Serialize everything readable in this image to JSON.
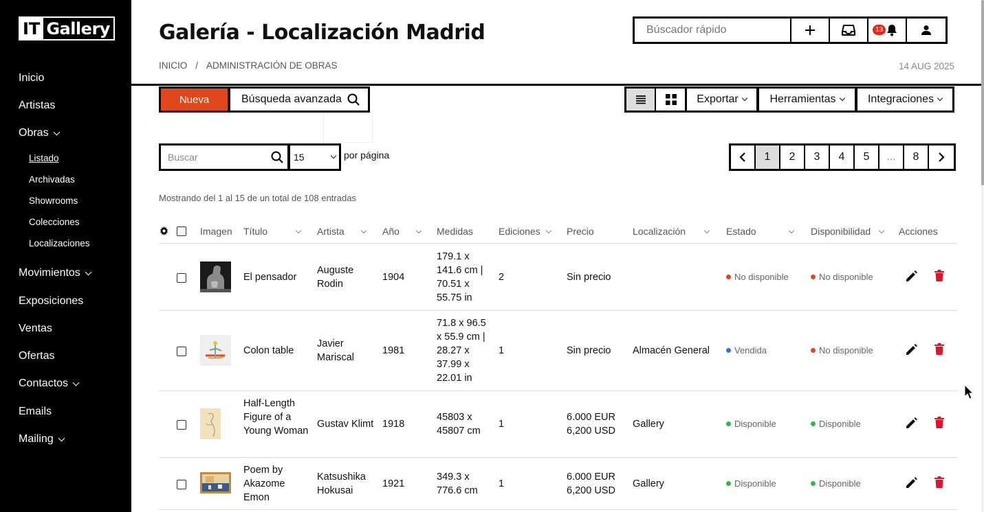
{
  "brand": {
    "logo_part1": "IT",
    "logo_part2": "Gallery"
  },
  "sidebar": {
    "items": [
      {
        "label": "Inicio",
        "has_children": false
      },
      {
        "label": "Artistas",
        "has_children": false
      },
      {
        "label": "Obras",
        "has_children": true
      },
      {
        "label": "Movimientos",
        "has_children": true
      },
      {
        "label": "Exposiciones",
        "has_children": false
      },
      {
        "label": "Ventas",
        "has_children": false
      },
      {
        "label": "Ofertas",
        "has_children": false
      },
      {
        "label": "Contactos",
        "has_children": true
      },
      {
        "label": "Emails",
        "has_children": false
      },
      {
        "label": "Mailing",
        "has_children": true
      }
    ],
    "obras_sub": [
      {
        "label": "Listado",
        "active": true
      },
      {
        "label": "Archivadas",
        "active": false
      },
      {
        "label": "Showrooms",
        "active": false
      },
      {
        "label": "Colecciones",
        "active": false
      },
      {
        "label": "Localizaciones",
        "active": false
      }
    ]
  },
  "header": {
    "title": "Galería - Localización Madrid",
    "breadcrumb": [
      "INICIO",
      "/",
      "ADMINISTRACIÓN DE OBRAS"
    ],
    "date": "14 AUG 2025",
    "quick_search_placeholder": "Búscador rápido",
    "notifications_count": "13"
  },
  "toolbar": {
    "new_label": "Nueva",
    "advanced_search_label": "Búsqueda avanzada",
    "export_label": "Exportar",
    "tools_label": "Herramientas",
    "integrations_label": "Integraciones",
    "active_view": "list"
  },
  "list_controls": {
    "search_placeholder": "Buscar",
    "per_page_value": "15",
    "per_page_label": "por página",
    "pages": [
      "1",
      "2",
      "3",
      "4",
      "5",
      "...",
      "8"
    ],
    "current_page": "1",
    "showing_text": "Mostrando del 1 al 15 de un total de 108 entradas"
  },
  "table": {
    "columns": [
      "Imagen",
      "Título",
      "Artista",
      "Año",
      "Medidas",
      "Ediciones",
      "Precio",
      "Localización",
      "Estado",
      "Disponibilidad",
      "Acciones"
    ],
    "rows": [
      {
        "title": "El pensador",
        "artist": "Auguste Rodin",
        "year": "1904",
        "size": "179.1 x 141.6 cm | 70.51 x 55.75 in",
        "editions": "2",
        "price": "Sin precio",
        "location": "",
        "estado": "No disponible",
        "estado_color": "#e0481b",
        "disp": "No disponible",
        "disp_color": "#e0481b"
      },
      {
        "title": "Colon table",
        "artist": "Javier Mariscal",
        "year": "1981",
        "size": "71.8 x 96.5 x 55.9 cm | 28.27 x 37.99 x 22.01 in",
        "editions": "1",
        "price": "Sin precio",
        "location": "Almacén General",
        "estado": "Vendida",
        "estado_color": "#3d6fe0",
        "disp": "No disponible",
        "disp_color": "#e0481b"
      },
      {
        "title": "Half-Length Figure of a Young Woman",
        "artist": "Gustav Klimt",
        "year": "1918",
        "size": "45803 x 45807 cm",
        "editions": "1",
        "price": "6.000 EUR 6,200 USD",
        "location": "Gallery",
        "estado": "Disponible",
        "estado_color": "#2db84a",
        "disp": "Disponible",
        "disp_color": "#2db84a"
      },
      {
        "title": "Poem by Akazome Emon",
        "artist": "Katsushika Hokusai",
        "year": "1921",
        "size": "349.3 x 776.6 cm",
        "editions": "1",
        "price": "6.000 EUR 6,200 USD",
        "location": "Gallery",
        "estado": "Disponible",
        "estado_color": "#2db84a",
        "disp": "Disponible",
        "disp_color": "#2db84a"
      }
    ]
  },
  "colors": {
    "accent": "#e0481b",
    "badge": "#e0291b",
    "delete": "#e0132b",
    "sidebar_bg": "#000000"
  }
}
